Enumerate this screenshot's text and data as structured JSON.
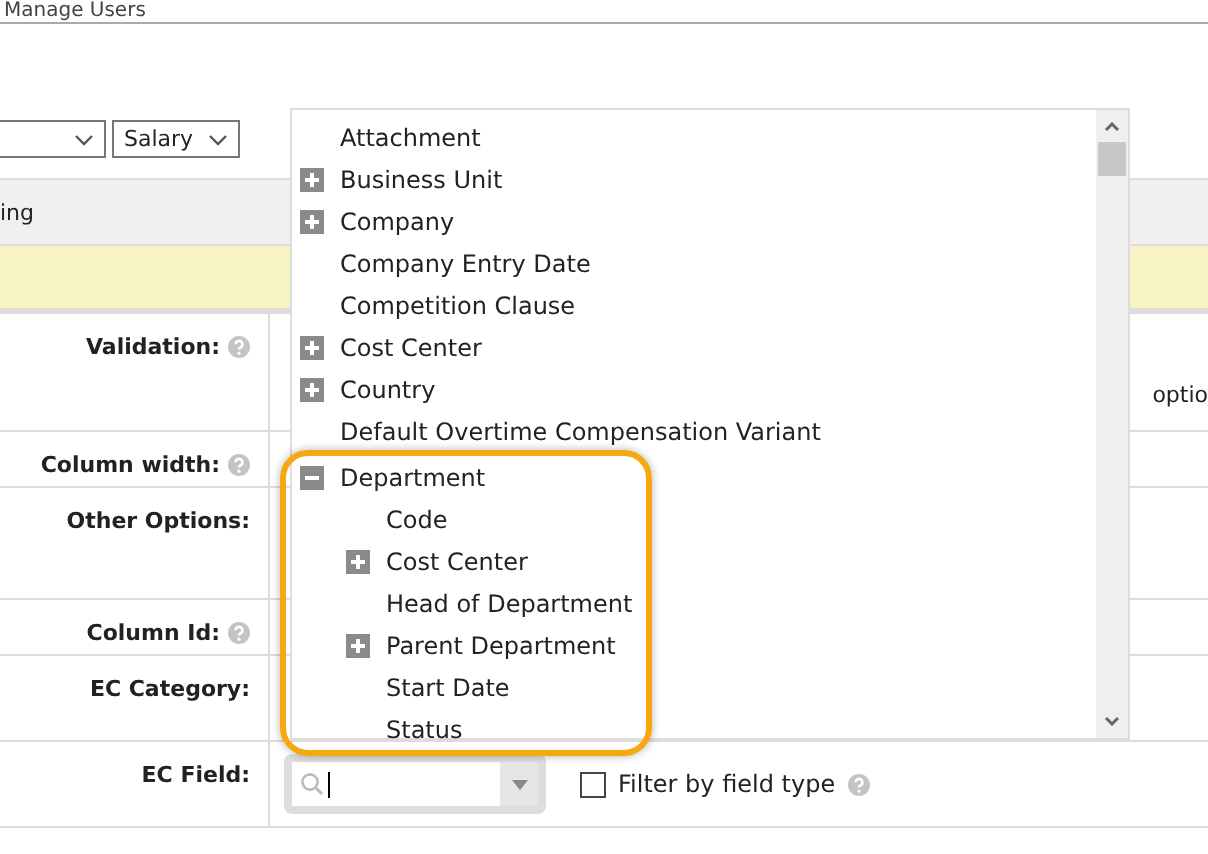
{
  "breadcrumb": {
    "label": "Manage Users"
  },
  "filters": [
    {
      "kind": "select"
    },
    {
      "kind": "select",
      "value": "Salary"
    }
  ],
  "table_header": {
    "column_1": "ing"
  },
  "form": {
    "rows": [
      {
        "label": "Validation:",
        "help": true
      },
      {
        "label": "Column width:",
        "help": true
      },
      {
        "label": "Other Options:",
        "help": false
      },
      {
        "label": "Column Id:",
        "help": true
      },
      {
        "label": "EC Category:",
        "help": false
      },
      {
        "label": "EC Field:",
        "help": false,
        "kind": "ec-field"
      }
    ],
    "side_text": "optio",
    "ec_field": {
      "filter_label": "Filter by field type",
      "filter_checked": false
    }
  },
  "dropdown": {
    "items": [
      {
        "label": "Attachment",
        "kind": "leaf"
      },
      {
        "label": "Business Unit",
        "kind": "group",
        "expanded": false
      },
      {
        "label": "Company",
        "kind": "group",
        "expanded": false
      },
      {
        "label": "Company Entry Date",
        "kind": "leaf"
      },
      {
        "label": "Competition Clause",
        "kind": "leaf"
      },
      {
        "label": "Cost Center",
        "kind": "group",
        "expanded": false
      },
      {
        "label": "Country",
        "kind": "group",
        "expanded": false
      },
      {
        "label": "Default Overtime Compensation Variant",
        "kind": "leaf"
      },
      {
        "label": "Department",
        "kind": "group",
        "expanded": true,
        "highlighted": true,
        "children": [
          {
            "label": "Code",
            "kind": "leaf"
          },
          {
            "label": "Cost Center",
            "kind": "group",
            "expanded": false
          },
          {
            "label": "Head of Department",
            "kind": "leaf"
          },
          {
            "label": "Parent Department",
            "kind": "group",
            "expanded": false
          },
          {
            "label": "Start Date",
            "kind": "leaf"
          },
          {
            "label": "Status",
            "kind": "leaf"
          }
        ]
      }
    ]
  }
}
